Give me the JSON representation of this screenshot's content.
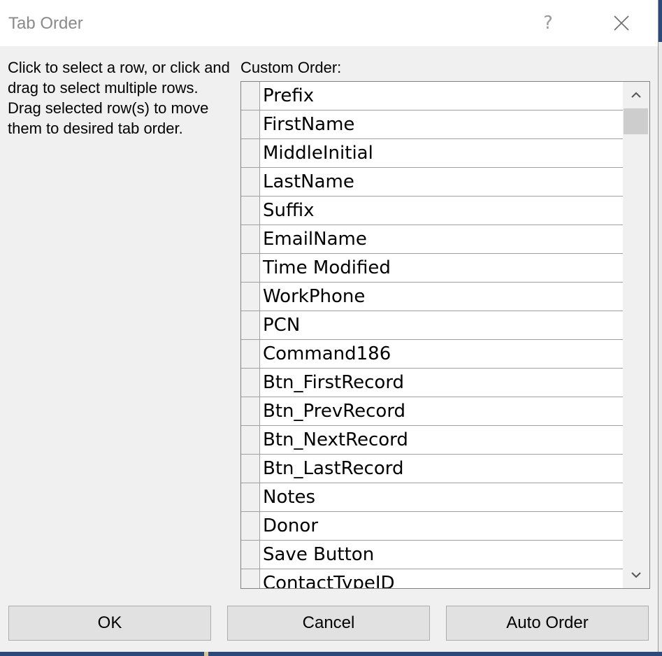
{
  "dialog": {
    "title": "Tab Order",
    "help_glyph": "?",
    "instructions": "Click to select a row, or click and drag to select multiple rows.  Drag selected row(s) to move them to desired tab order.",
    "custom_order_label": "Custom Order:"
  },
  "rows": [
    "Prefix",
    "FirstName",
    "MiddleInitial",
    "LastName",
    "Suffix",
    "EmailName",
    "Time Modified",
    "WorkPhone",
    "PCN",
    "Command186",
    "Btn_FirstRecord",
    "Btn_PrevRecord",
    "Btn_NextRecord",
    "Btn_LastRecord",
    "Notes",
    "Donor",
    "Save Button",
    "ContactTypeID"
  ],
  "buttons": {
    "ok": "OK",
    "cancel": "Cancel",
    "auto_order": "Auto Order"
  },
  "icons": {
    "close": "close-icon",
    "scroll_up": "chevron-up-icon",
    "scroll_down": "chevron-down-icon"
  }
}
